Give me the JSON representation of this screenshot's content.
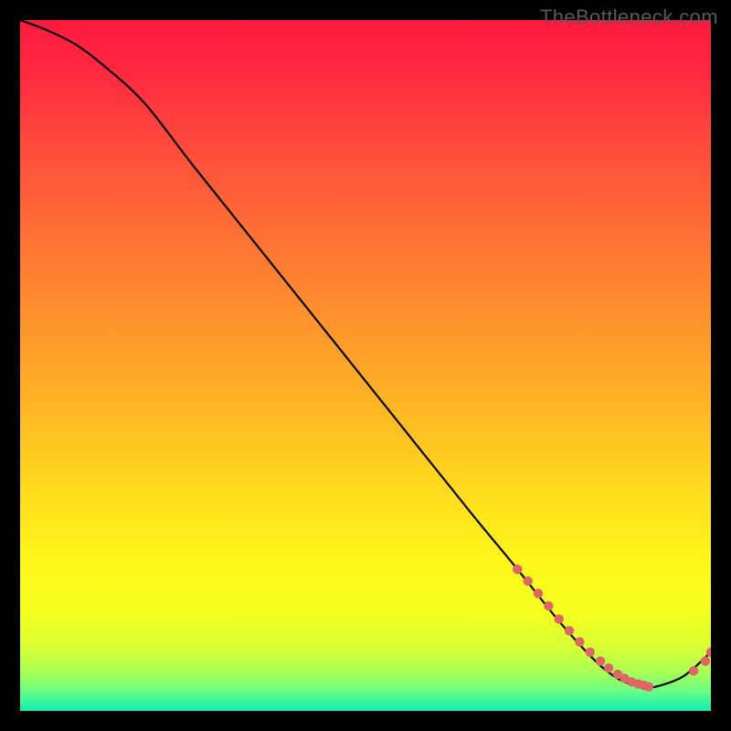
{
  "watermark": "TheBottleneck.com",
  "chart_data": {
    "type": "line",
    "title": "",
    "xlabel": "",
    "ylabel": "",
    "xlim": [
      0,
      100
    ],
    "ylim": [
      0,
      100
    ],
    "grid": false,
    "legend": false,
    "curve": {
      "name": "bottleneck-curve",
      "x": [
        0,
        4,
        8,
        12,
        18,
        25,
        35,
        45,
        55,
        65,
        72,
        78,
        83,
        86,
        88,
        90,
        92,
        96,
        100
      ],
      "y": [
        100,
        98.5,
        96.5,
        93.5,
        88,
        79,
        66.5,
        54,
        41.5,
        29,
        20.5,
        13,
        7.5,
        5,
        4,
        3.5,
        3.5,
        5,
        8.5
      ]
    },
    "markers": {
      "name": "highlight-markers",
      "color": "#e06666",
      "x": [
        72,
        73.5,
        75,
        76.5,
        78,
        79.5,
        81,
        82.5,
        84,
        85.2,
        86.5,
        87.5,
        88.5,
        89.5,
        90.3,
        91,
        97.5,
        99.2,
        100
      ],
      "y": [
        20.5,
        18.8,
        17,
        15.2,
        13.3,
        11.6,
        10,
        8.5,
        7.2,
        6.2,
        5.3,
        4.7,
        4.2,
        3.9,
        3.7,
        3.5,
        5.8,
        7.2,
        8.5
      ]
    },
    "background_gradient": {
      "type": "vertical-linear",
      "stops": [
        {
          "offset": 0.0,
          "color": "#ff1a3f"
        },
        {
          "offset": 0.07,
          "color": "#ff2740"
        },
        {
          "offset": 0.18,
          "color": "#ff4a3c"
        },
        {
          "offset": 0.3,
          "color": "#ff6d35"
        },
        {
          "offset": 0.42,
          "color": "#ff8f2d"
        },
        {
          "offset": 0.55,
          "color": "#ffb325"
        },
        {
          "offset": 0.67,
          "color": "#ffd81e"
        },
        {
          "offset": 0.78,
          "color": "#fff61a"
        },
        {
          "offset": 0.86,
          "color": "#f4ff1f"
        },
        {
          "offset": 0.91,
          "color": "#d6ff34"
        },
        {
          "offset": 0.945,
          "color": "#a7ff56"
        },
        {
          "offset": 0.97,
          "color": "#6cff82"
        },
        {
          "offset": 0.988,
          "color": "#33f7a3"
        },
        {
          "offset": 1.0,
          "color": "#18e8b0"
        }
      ]
    }
  }
}
